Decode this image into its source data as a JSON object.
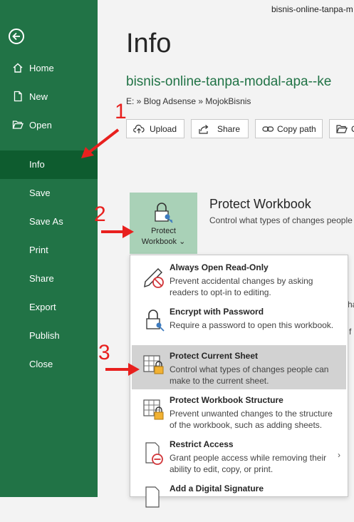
{
  "window_title": "bisnis-online-tanpa-m",
  "sidebar": {
    "back_icon": "back-arrow-icon",
    "items": [
      {
        "label": "Home",
        "icon": "home-icon"
      },
      {
        "label": "New",
        "icon": "new-doc-icon"
      },
      {
        "label": "Open",
        "icon": "folder-icon"
      },
      {
        "label": "Info",
        "active": true
      },
      {
        "label": "Save"
      },
      {
        "label": "Save As"
      },
      {
        "label": "Print"
      },
      {
        "label": "Share"
      },
      {
        "label": "Export"
      },
      {
        "label": "Publish"
      },
      {
        "label": "Close"
      }
    ],
    "colors": {
      "bg": "#217346",
      "active": "#0e5c2f"
    }
  },
  "main": {
    "heading": "Info",
    "file_name": "bisnis-online-tanpa-modal-apa--ke",
    "path": "E: » Blog Adsense » MojokBisnis",
    "buttons": [
      {
        "label": "Upload",
        "icon": "upload-icon"
      },
      {
        "label": "Share",
        "icon": "share-icon"
      },
      {
        "label": "Copy path",
        "icon": "link-icon"
      },
      {
        "label": "O",
        "icon": "folder-icon"
      }
    ],
    "protect": {
      "tile_label_1": "Protect",
      "tile_label_2": "Workbook",
      "title": "Protect Workbook",
      "description": "Control what types of changes people"
    },
    "peek_1": "ha",
    "peek_2": "f"
  },
  "menu": {
    "items": [
      {
        "title": "Always Open Read-Only",
        "description": "Prevent accidental changes by asking readers to opt-in to editing.",
        "icon": "pencil-no-icon"
      },
      {
        "title": "Encrypt with Password",
        "description": "Require a password to open this workbook.",
        "icon": "lock-key-icon"
      },
      {
        "title": "Protect Current Sheet",
        "description": "Control what types of changes people can make to the current sheet.",
        "icon": "sheet-lock-icon",
        "highlighted": true
      },
      {
        "title": "Protect Workbook Structure",
        "description": "Prevent unwanted changes to the structure of the workbook, such as adding sheets.",
        "icon": "workbook-lock-icon"
      },
      {
        "title": "Restrict Access",
        "description": "Grant people access while removing their ability to edit, copy, or print.",
        "icon": "doc-restrict-icon",
        "has_submenu": true
      },
      {
        "title": "Add a Digital Signature",
        "description": "",
        "icon": "signature-icon"
      }
    ]
  },
  "annotations": {
    "step_1": "1",
    "step_2": "2",
    "step_3": "3",
    "color": "#e8201e"
  }
}
